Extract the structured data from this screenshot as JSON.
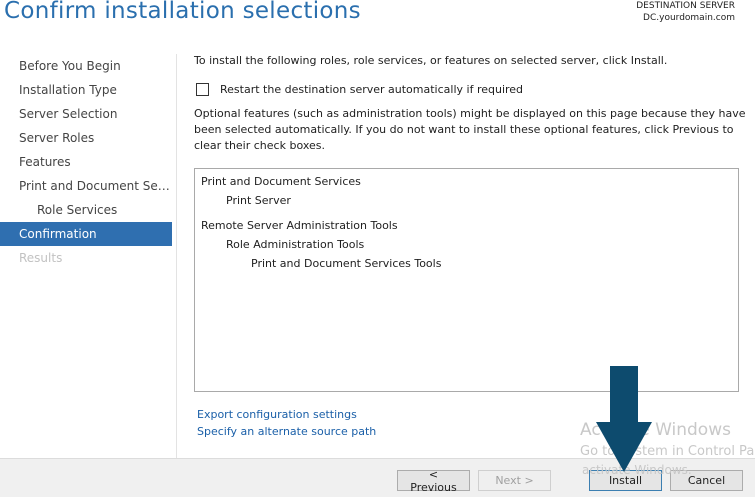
{
  "header": {
    "title": "Confirm installation selections",
    "destination_label": "DESTINATION SERVER",
    "destination_server": "DC.yourdomain.com"
  },
  "sidebar": {
    "items": [
      {
        "label": "Before You Begin",
        "state": "normal"
      },
      {
        "label": "Installation Type",
        "state": "normal"
      },
      {
        "label": "Server Selection",
        "state": "normal"
      },
      {
        "label": "Server Roles",
        "state": "normal"
      },
      {
        "label": "Features",
        "state": "normal"
      },
      {
        "label": "Print and Document Servi...",
        "state": "normal"
      },
      {
        "label": "Role Services",
        "state": "sub"
      },
      {
        "label": "Confirmation",
        "state": "active"
      },
      {
        "label": "Results",
        "state": "disabled"
      }
    ]
  },
  "main": {
    "intro": "To install the following roles, role services, or features on selected server, click Install.",
    "restart_checkbox": {
      "label": "Restart the destination server automatically if required",
      "checked": false
    },
    "optional_note": "Optional features (such as administration tools) might be displayed on this page because they have been selected automatically. If you do not want to install these optional features, click Previous to clear their check boxes.",
    "selections": [
      {
        "text": "Print and Document Services",
        "level": 0
      },
      {
        "text": "Print Server",
        "level": 1
      },
      {
        "text": "Remote Server Administration Tools",
        "level": 0
      },
      {
        "text": "Role Administration Tools",
        "level": 1
      },
      {
        "text": "Print and Document Services Tools",
        "level": 2
      }
    ],
    "links": {
      "export": "Export configuration settings",
      "alternate_source": "Specify an alternate source path"
    }
  },
  "footer": {
    "previous": "< Previous",
    "next": "Next >",
    "install": "Install",
    "cancel": "Cancel"
  },
  "watermark": {
    "line1": "Activate Windows",
    "line2": "Go to System in Control Panel to",
    "line3": "activate Windows."
  },
  "colors": {
    "title": "#2a6fae",
    "selected_nav": "#2f6fb0",
    "link": "#1a5fa8",
    "arrow": "#0d4b6e"
  }
}
